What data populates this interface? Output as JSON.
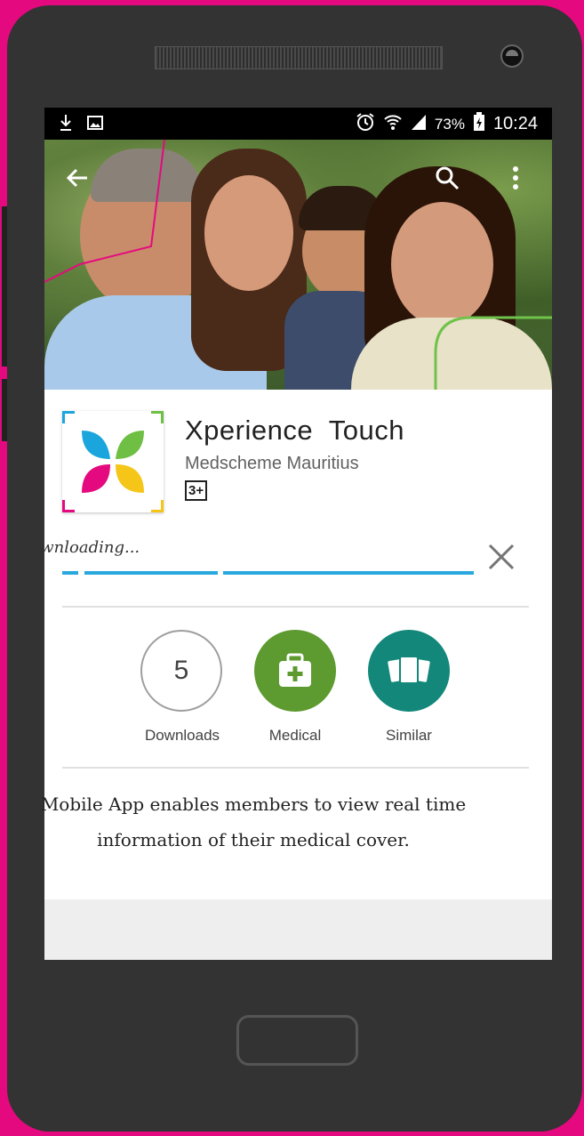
{
  "status_bar": {
    "battery": "73%",
    "time": "10:24"
  },
  "app": {
    "title": "Xperience  Touch",
    "developer": "Medscheme Mauritius",
    "content_rating": "3+"
  },
  "download": {
    "status_text": "Downloading...",
    "progress": 0.0
  },
  "stats": {
    "downloads_value": "5",
    "downloads_label": "Downloads",
    "medical_label": "Medical",
    "similar_label": "Similar"
  },
  "description": "Mobile App enables members to view real time information of their medical cover.",
  "colors": {
    "background": "#e5097f",
    "device_body": "#333333",
    "progress_blue": "#29a8de",
    "medical_green": "#5d9a2f",
    "similar_teal": "#12877a"
  },
  "icons": {
    "back": "arrow-left-icon",
    "search": "search-icon",
    "menu": "overflow-menu-icon",
    "cancel": "close-icon",
    "medical": "medical-kit-icon",
    "similar": "cards-stack-icon"
  }
}
